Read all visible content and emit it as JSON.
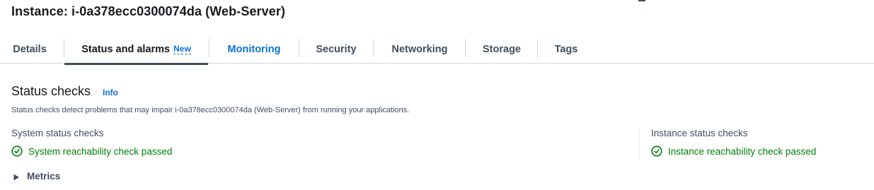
{
  "header": {
    "title": "Instance: i-0a378ecc0300074da (Web-Server)"
  },
  "tabs": [
    {
      "label": "Details"
    },
    {
      "label": "Status and alarms",
      "badge": "New"
    },
    {
      "label": "Monitoring"
    },
    {
      "label": "Security"
    },
    {
      "label": "Networking"
    },
    {
      "label": "Storage"
    },
    {
      "label": "Tags"
    }
  ],
  "status_checks": {
    "title": "Status checks",
    "info_label": "Info",
    "description": "Status checks detect problems that may impair i-0a378ecc0300074da (Web-Server) from running your applications.",
    "system": {
      "label": "System status checks",
      "result": "System reachability check passed",
      "icon": "check-circle-icon"
    },
    "instance": {
      "label": "Instance status checks",
      "result": "Instance reachability check passed",
      "icon": "check-circle-icon"
    },
    "metrics_label": "Metrics"
  },
  "colors": {
    "success": "#037f0c",
    "link": "#0972d3",
    "text": "#16191f",
    "muted": "#414d5c"
  }
}
